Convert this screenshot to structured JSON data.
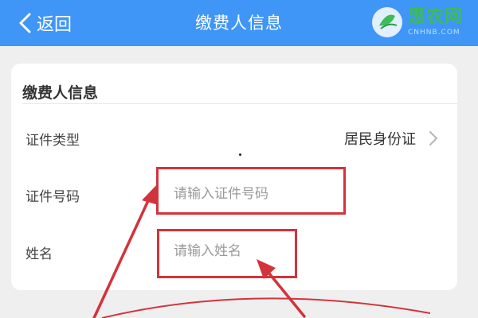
{
  "navbar": {
    "back_label": "返回",
    "title": "缴费人信息"
  },
  "watermark": {
    "name": "惠农网",
    "domain": "CNHNB.COM"
  },
  "card": {
    "title": "缴费人信息",
    "rows": [
      {
        "label": "证件类型",
        "value": "居民身份证"
      },
      {
        "label": "证件号码",
        "placeholder": "请输入证件号码"
      },
      {
        "label": "姓名",
        "placeholder": "请输入姓名"
      }
    ]
  },
  "colors": {
    "navbar": "#3f96f7",
    "background": "#efefef",
    "card": "#ffffff",
    "annotation_red": "#d3333b",
    "watermark_green": "#3dbb59"
  },
  "icons": [
    "back-chevron-icon",
    "chevron-right-icon",
    "watermark-logo-icon",
    "annotation-arrow-icon"
  ]
}
